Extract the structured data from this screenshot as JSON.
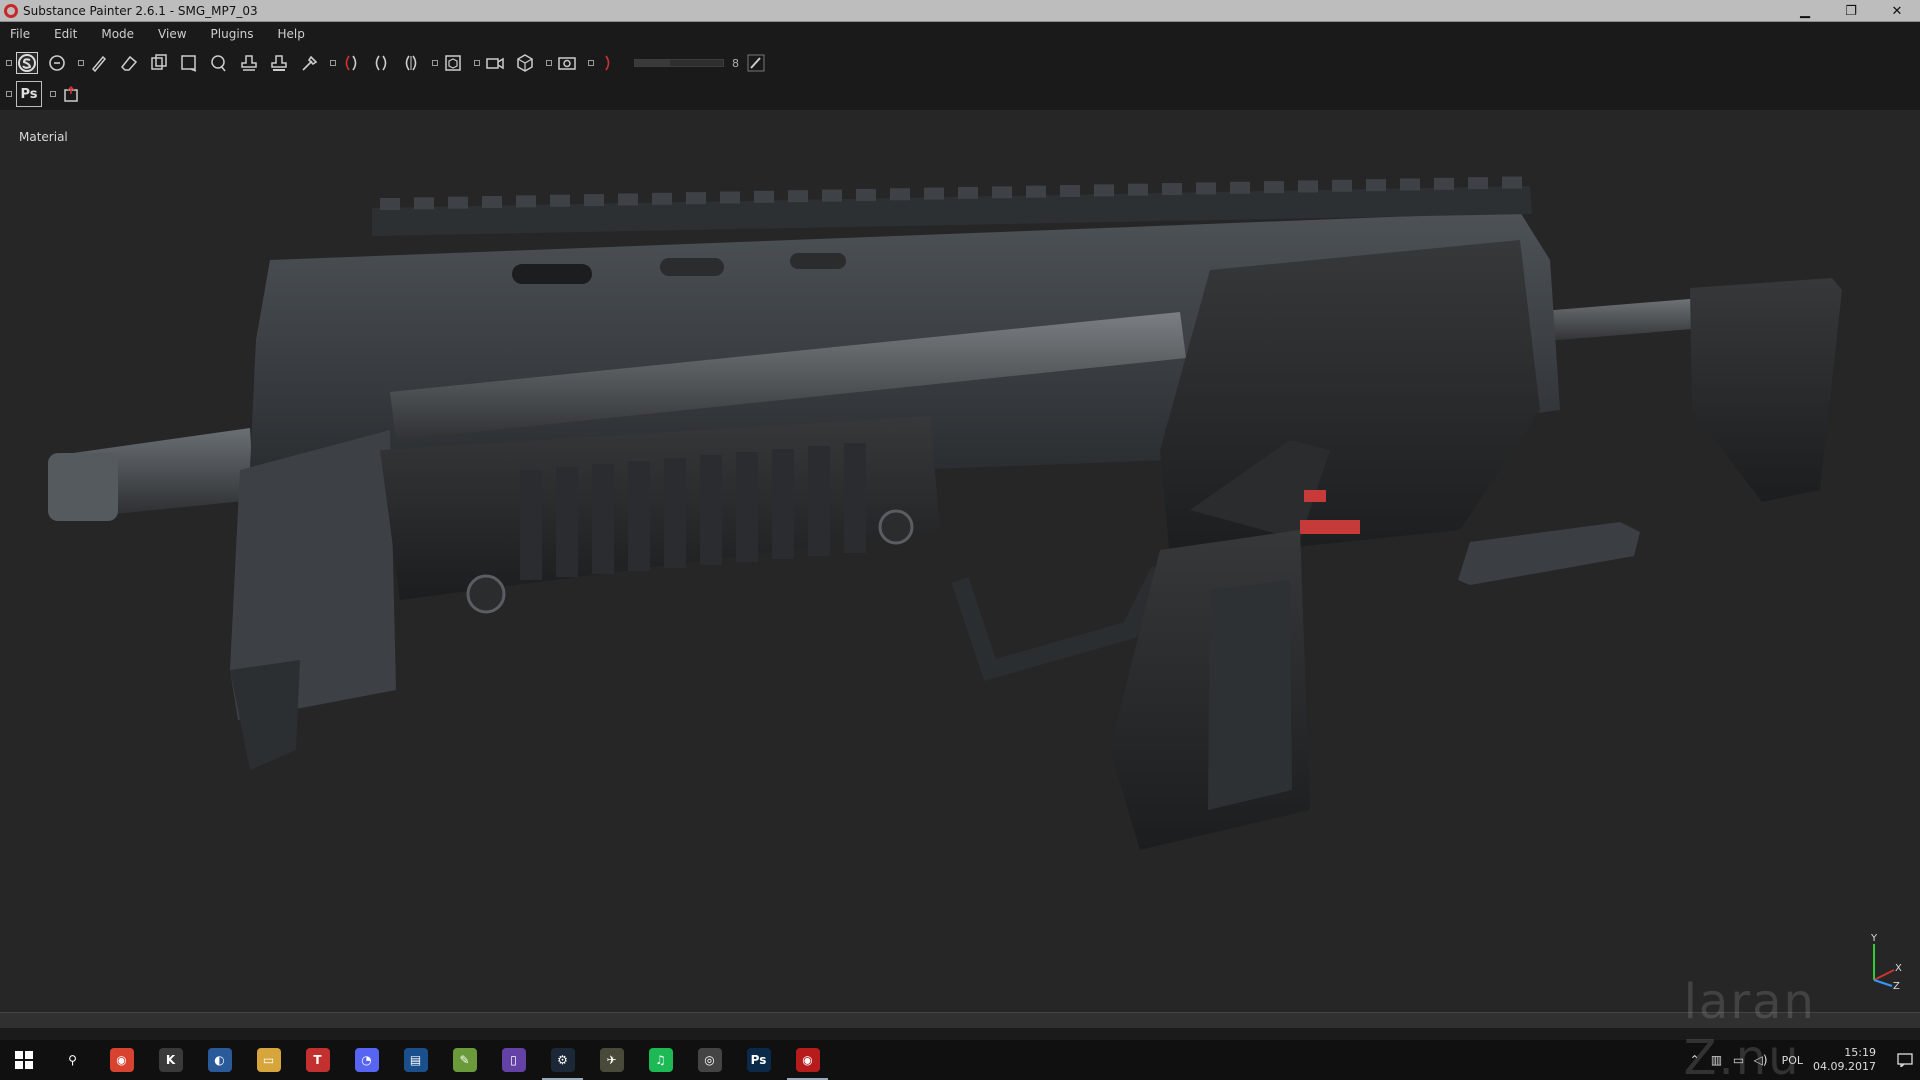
{
  "window": {
    "title": "Substance Painter 2.6.1 - SMG_MP7_03",
    "minimize_glyph": "▁",
    "restore_glyph": "❐",
    "close_glyph": "✕"
  },
  "menu": [
    "File",
    "Edit",
    "Mode",
    "View",
    "Plugins",
    "Help"
  ],
  "toolbar": {
    "row1_tools": [
      "substance-logo-icon",
      "polygon-fill-icon",
      "paint-brush-icon",
      "eraser-icon",
      "projection-icon",
      "geometry-mask-icon",
      "smudge-icon",
      "clone-icon",
      "stamp-icon",
      "color-picker-icon",
      "symmetry-x-icon",
      "symmetry-y-icon",
      "symmetry-z-icon",
      "camera-view-icon",
      "camera-icon",
      "material-ball-icon",
      "screenshot-icon",
      "environment-icon"
    ],
    "brush_size_value": "8",
    "brush_size_fraction": 0.4,
    "ps_label": "Ps",
    "row2_tools": [
      "photoshop-export-icon",
      "export-textures-icon"
    ]
  },
  "viewport": {
    "channel_label": "Material",
    "axis": {
      "y": "Y",
      "x": "X",
      "z": "Z"
    },
    "watermark": "laran Z.nu"
  },
  "taskbar": {
    "apps": [
      {
        "name": "search",
        "glyph": "⚲",
        "color": "#101010"
      },
      {
        "name": "chrome",
        "glyph": "◉",
        "color": "#d8432f"
      },
      {
        "name": "wot",
        "glyph": "K",
        "color": "#3a3a3a"
      },
      {
        "name": "edge",
        "glyph": "◐",
        "color": "#2a5a9a"
      },
      {
        "name": "explorer",
        "glyph": "▭",
        "color": "#d6a53b"
      },
      {
        "name": "teamspeak",
        "glyph": "T",
        "color": "#c23030"
      },
      {
        "name": "discord",
        "glyph": "◔",
        "color": "#5865f2"
      },
      {
        "name": "battlenet",
        "glyph": "▤",
        "color": "#1a4f8c"
      },
      {
        "name": "notepad",
        "glyph": "✎",
        "color": "#6a9a3a"
      },
      {
        "name": "twitch",
        "glyph": "▯",
        "color": "#6441a5"
      },
      {
        "name": "steam",
        "glyph": "⚙",
        "color": "#1b2838"
      },
      {
        "name": "game",
        "glyph": "✈",
        "color": "#4a4a3a"
      },
      {
        "name": "spotify",
        "glyph": "♫",
        "color": "#1db954"
      },
      {
        "name": "substance-designer",
        "glyph": "◎",
        "color": "#444"
      },
      {
        "name": "photoshop",
        "glyph": "Ps",
        "color": "#0b2a4a"
      },
      {
        "name": "substance-painter",
        "glyph": "◉",
        "color": "#b71c1c"
      }
    ],
    "lang": "POL",
    "time": "15:19",
    "date": "04.09.2017"
  }
}
